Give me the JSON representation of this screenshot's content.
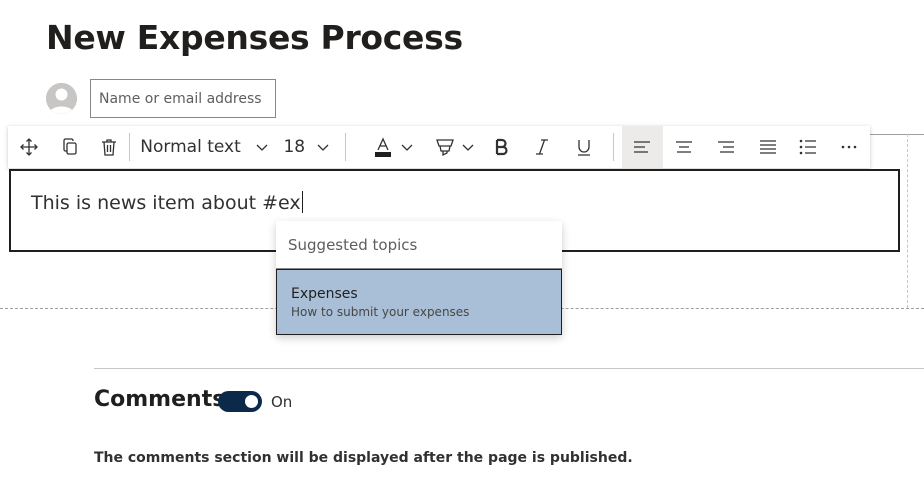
{
  "page": {
    "title": "New Expenses Process"
  },
  "author": {
    "placeholder": "Name or email address"
  },
  "toolbar": {
    "style_label": "Normal text",
    "font_size": "18",
    "icons": [
      "move-icon",
      "copy-icon",
      "trash-icon",
      "font-color-icon",
      "highlight-icon",
      "bold-icon",
      "italic-icon",
      "underline-icon",
      "align-left-icon",
      "align-center-icon",
      "align-right-icon",
      "justify-icon",
      "bullet-list-icon",
      "more-icon"
    ],
    "colors": {
      "font_color_bar": "#201f1e",
      "active_bg": "#edebe9"
    }
  },
  "editor": {
    "text": "This is news item about #ex"
  },
  "suggestions": {
    "header": "Suggested topics",
    "items": [
      {
        "title": "Expenses",
        "subtitle": "How to submit your expenses"
      }
    ],
    "colors": {
      "selected_bg": "#a9bfd7"
    }
  },
  "comments": {
    "title": "Comments",
    "toggle_label": "On",
    "toggle_on": true,
    "note": "The comments section will be displayed after the page is published.",
    "colors": {
      "toggle_bg": "#0b2a4a"
    }
  }
}
